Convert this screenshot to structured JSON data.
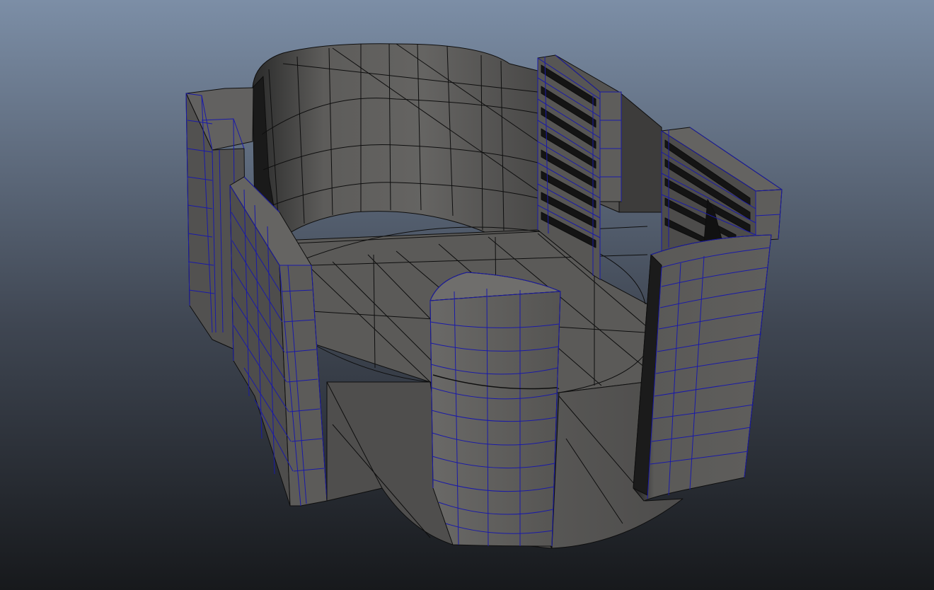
{
  "viewport": {
    "background_top": "#7c8ea6",
    "background_mid": "#3f4652",
    "background_bottom": "#17191c"
  },
  "model": {
    "surface_color": "#5a5957",
    "surface_light": "#6c6b69",
    "surface_dark": "#3a3938",
    "shadow_color": "#161616",
    "edge_color": "#0e0e0e",
    "selected_edge_color": "#1a1aa8"
  }
}
